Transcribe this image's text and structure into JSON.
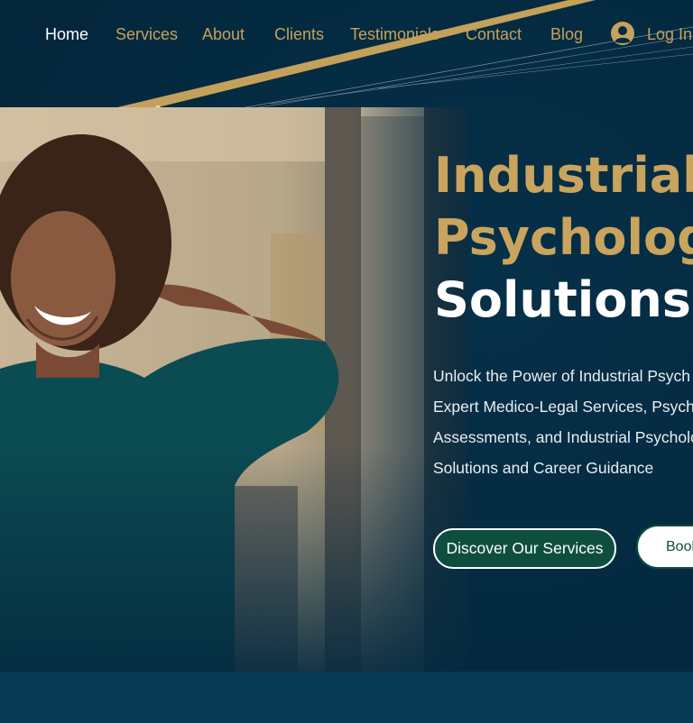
{
  "nav": {
    "items": [
      {
        "label": "Home"
      },
      {
        "label": "Services"
      },
      {
        "label": "About"
      },
      {
        "label": "Clients"
      },
      {
        "label": "Testimonials"
      },
      {
        "label": "Contact"
      },
      {
        "label": "Blog"
      }
    ],
    "login_label": "Log In"
  },
  "hero": {
    "headline_line1": "Industrial",
    "headline_line2": "Psychology",
    "headline_line3": "Solutions",
    "subtext_lines": [
      "Unlock the Power of Industrial Psych",
      "Expert Medico-Legal Services, Psych",
      "Assessments, and Industrial Psycholo",
      "Solutions and Career Guidance"
    ],
    "primary_button": "Discover Our Services",
    "secondary_button": "Book"
  },
  "colors": {
    "background": "#042a40",
    "gold_accent": "#c9a45e",
    "button_green": "#0e4e3f",
    "text_white": "#ffffff"
  },
  "icons": {
    "login": "account-circle-icon"
  }
}
